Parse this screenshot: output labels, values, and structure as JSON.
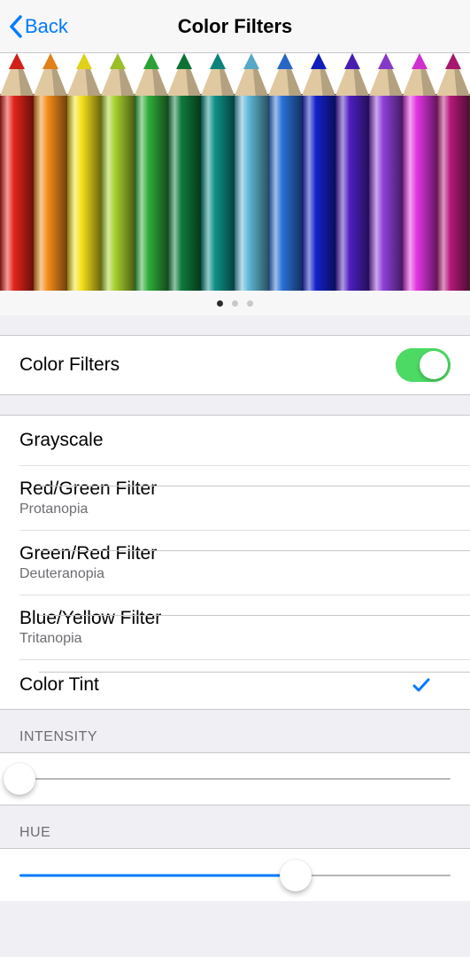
{
  "nav": {
    "back_label": "Back",
    "title": "Color Filters"
  },
  "preview": {
    "pencil_colors": [
      "#e2231a",
      "#f28c1a",
      "#f5e21c",
      "#a7cf2b",
      "#2fae3a",
      "#0e7a3a",
      "#0d8f86",
      "#5fb7d6",
      "#2a6fd6",
      "#1221c9",
      "#4d1fc0",
      "#8f3fd8",
      "#e233e2",
      "#b51979",
      "#6e3a1f"
    ],
    "page_index": 0,
    "page_count": 3
  },
  "toggle_row": {
    "label": "Color Filters",
    "on": true
  },
  "filter_options": [
    {
      "label": "Grayscale",
      "sub": "",
      "selected": false
    },
    {
      "label": "Red/Green Filter",
      "sub": "Protanopia",
      "selected": false
    },
    {
      "label": "Green/Red Filter",
      "sub": "Deuteranopia",
      "selected": false
    },
    {
      "label": "Blue/Yellow Filter",
      "sub": "Tritanopia",
      "selected": false
    },
    {
      "label": "Color Tint",
      "sub": "",
      "selected": true
    }
  ],
  "sliders": {
    "intensity": {
      "header": "INTENSITY",
      "value": 0.0
    },
    "hue": {
      "header": "HUE",
      "value": 0.64
    }
  },
  "colors": {
    "tint_blue": "#007aff",
    "switch_green": "#4cd964"
  }
}
